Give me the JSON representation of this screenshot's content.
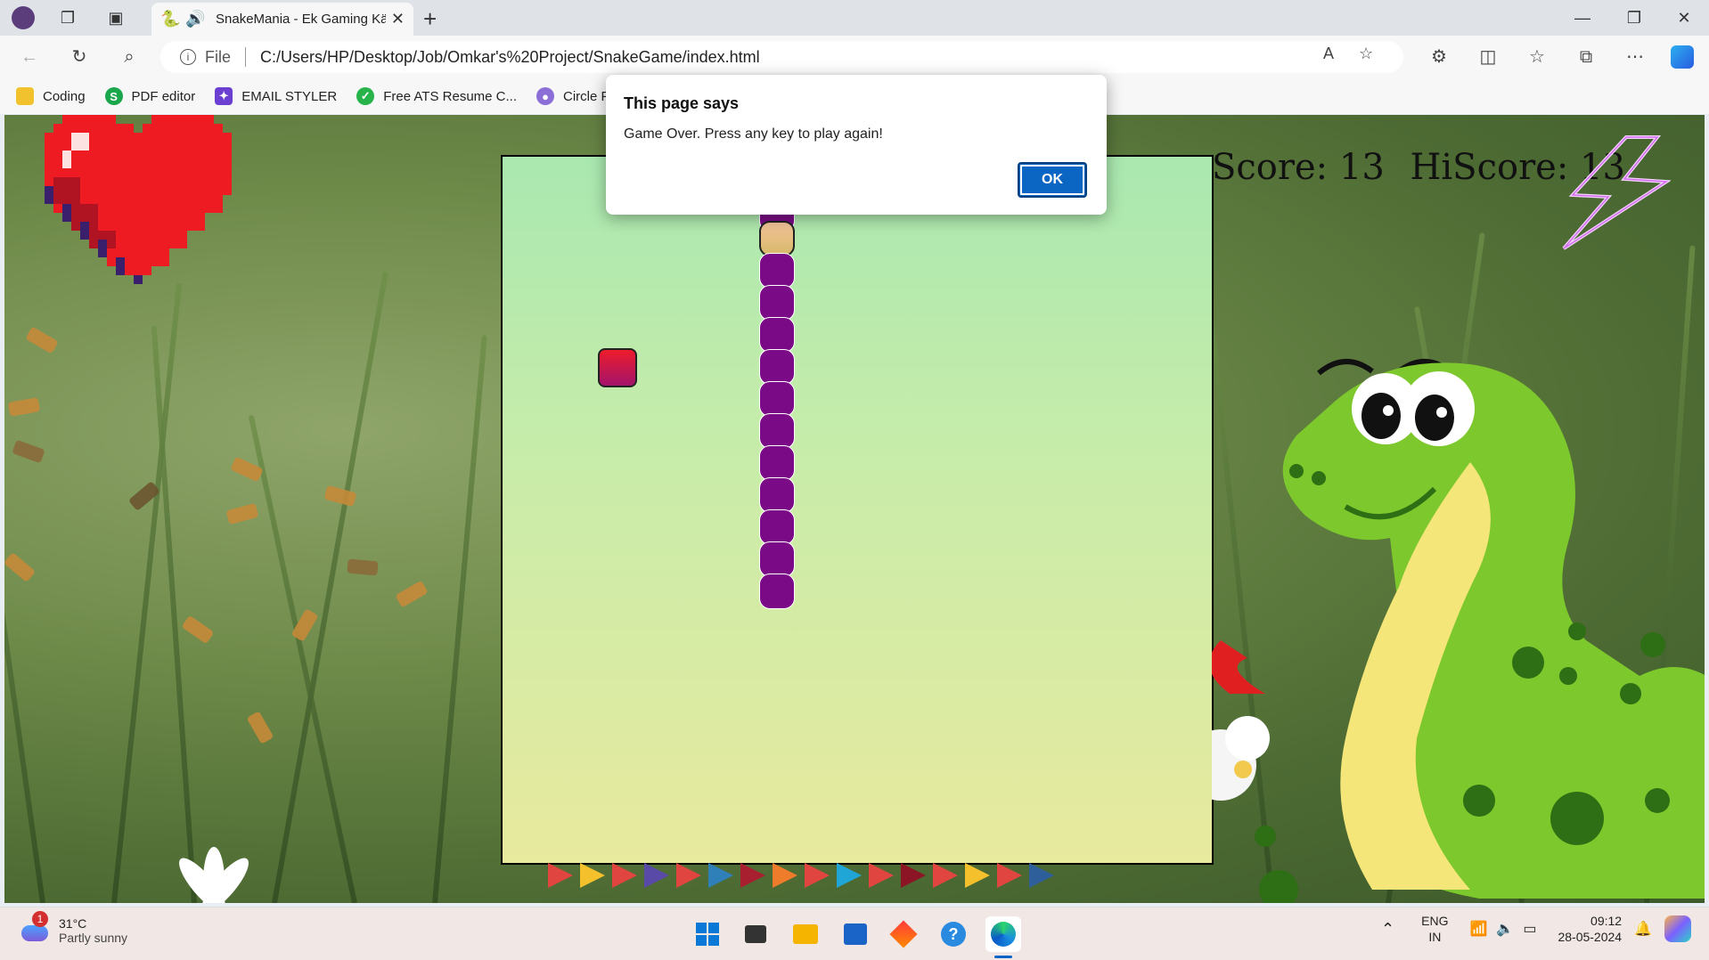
{
  "browser": {
    "tab_title": "SnakeMania - Ek Gaming Kä",
    "new_tab": "+",
    "url_scheme": "File",
    "url": "C:/Users/HP/Desktop/Job/Omkar's%20Project/SnakeGame/index.html"
  },
  "bookmarks": [
    {
      "label": "Coding",
      "color": "#f2c12e"
    },
    {
      "label": "PDF editor",
      "color": "#1aa64a"
    },
    {
      "label": "EMAIL STYLER",
      "color": "#6a3fd1"
    },
    {
      "label": "Free ATS Resume C...",
      "color": "#27b34a"
    },
    {
      "label": "Circle Profile",
      "color": "#8b6fd6"
    }
  ],
  "game": {
    "score_label": "Score: 13",
    "hiscore_label": "HiScore: 13",
    "score": 13,
    "hiscore": 13
  },
  "dialog": {
    "title": "This page says",
    "message": "Game Over. Press any key to play again!",
    "ok": "OK"
  },
  "taskbar": {
    "temperature": "31°C",
    "condition": "Partly sunny",
    "weather_badge": "1",
    "lang_top": "ENG",
    "lang_bottom": "IN",
    "time": "09:12",
    "date": "28-05-2024"
  }
}
